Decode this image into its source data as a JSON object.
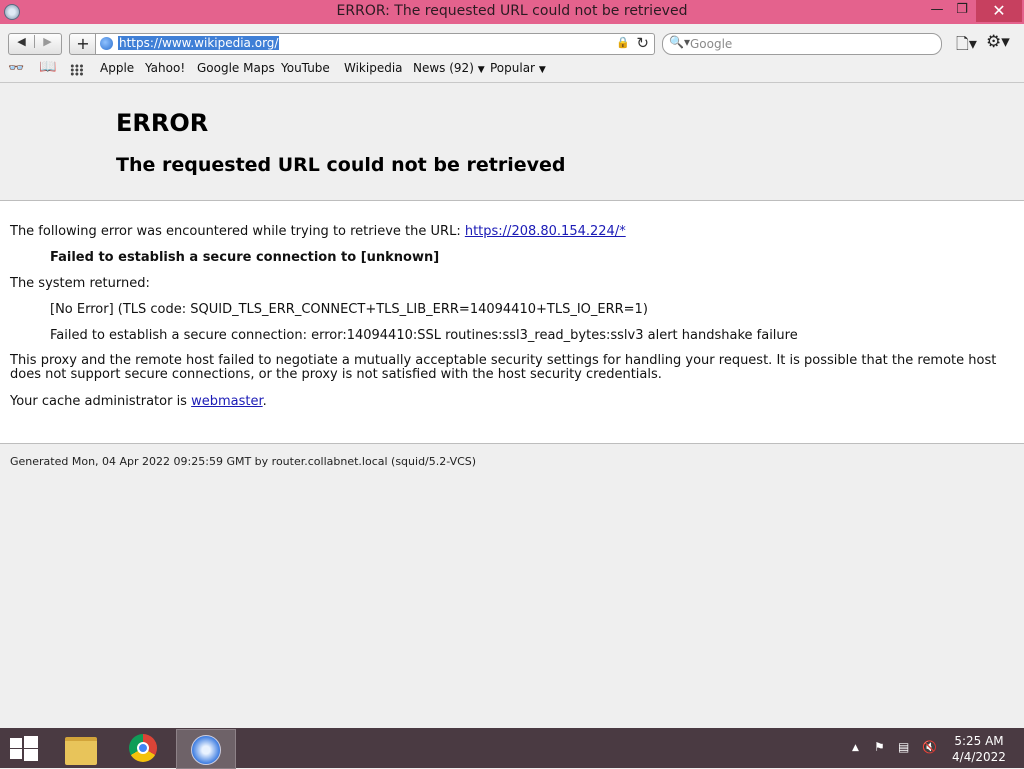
{
  "window": {
    "title": "ERROR: The requested URL could not be retrieved"
  },
  "toolbar": {
    "url": "https://www.wikipedia.org/",
    "search_placeholder": "Google"
  },
  "bookmarks": {
    "items": [
      "Apple",
      "Yahoo!",
      "Google Maps",
      "YouTube",
      "Wikipedia",
      "News (92)",
      "Popular"
    ]
  },
  "page": {
    "heading": "ERROR",
    "subheading": "The requested URL could not be retrieved",
    "intro": "The following error was encountered while trying to retrieve the URL: ",
    "error_url": "https://208.80.154.224/*",
    "error_summary": "Failed to establish a secure connection to [unknown]",
    "system_returned": "The system returned:",
    "tls_code": "[No Error] (TLS code: SQUID_TLS_ERR_CONNECT+TLS_LIB_ERR=14094410+TLS_IO_ERR=1)",
    "ssl_error": "Failed to establish a secure connection: error:14094410:SSL routines:ssl3_read_bytes:sslv3 alert handshake failure",
    "explanation": "This proxy and the remote host failed to negotiate a mutually acceptable security settings for handling your request. It is possible that the remote host does not support secure connections, or the proxy is not satisfied with the host security credentials.",
    "admin_prefix": "Your cache administrator is ",
    "admin_link": "webmaster",
    "admin_suffix": ".",
    "footer": "Generated Mon, 04 Apr 2022 09:25:59 GMT by router.collabnet.local (squid/5.2-VCS)"
  },
  "taskbar": {
    "time": "5:25 AM",
    "date": "4/4/2022"
  },
  "colors": {
    "titlebar": "#e4628d",
    "taskbar": "#4a3a42",
    "link": "#1b1bb6",
    "url_selection": "#3f7fd6"
  },
  "icons": [
    "app-icon",
    "back-icon",
    "forward-icon",
    "add-icon",
    "globe-icon",
    "lock-icon",
    "reload-icon",
    "search-icon",
    "page-menu-icon",
    "gear-icon",
    "reading-list-icon",
    "bookmarks-book-icon",
    "top-sites-grid-icon",
    "windows-start-icon",
    "file-explorer-icon",
    "chrome-icon",
    "safari-icon",
    "tray-arrow-icon",
    "flag-icon",
    "network-icon",
    "volume-icon"
  ]
}
